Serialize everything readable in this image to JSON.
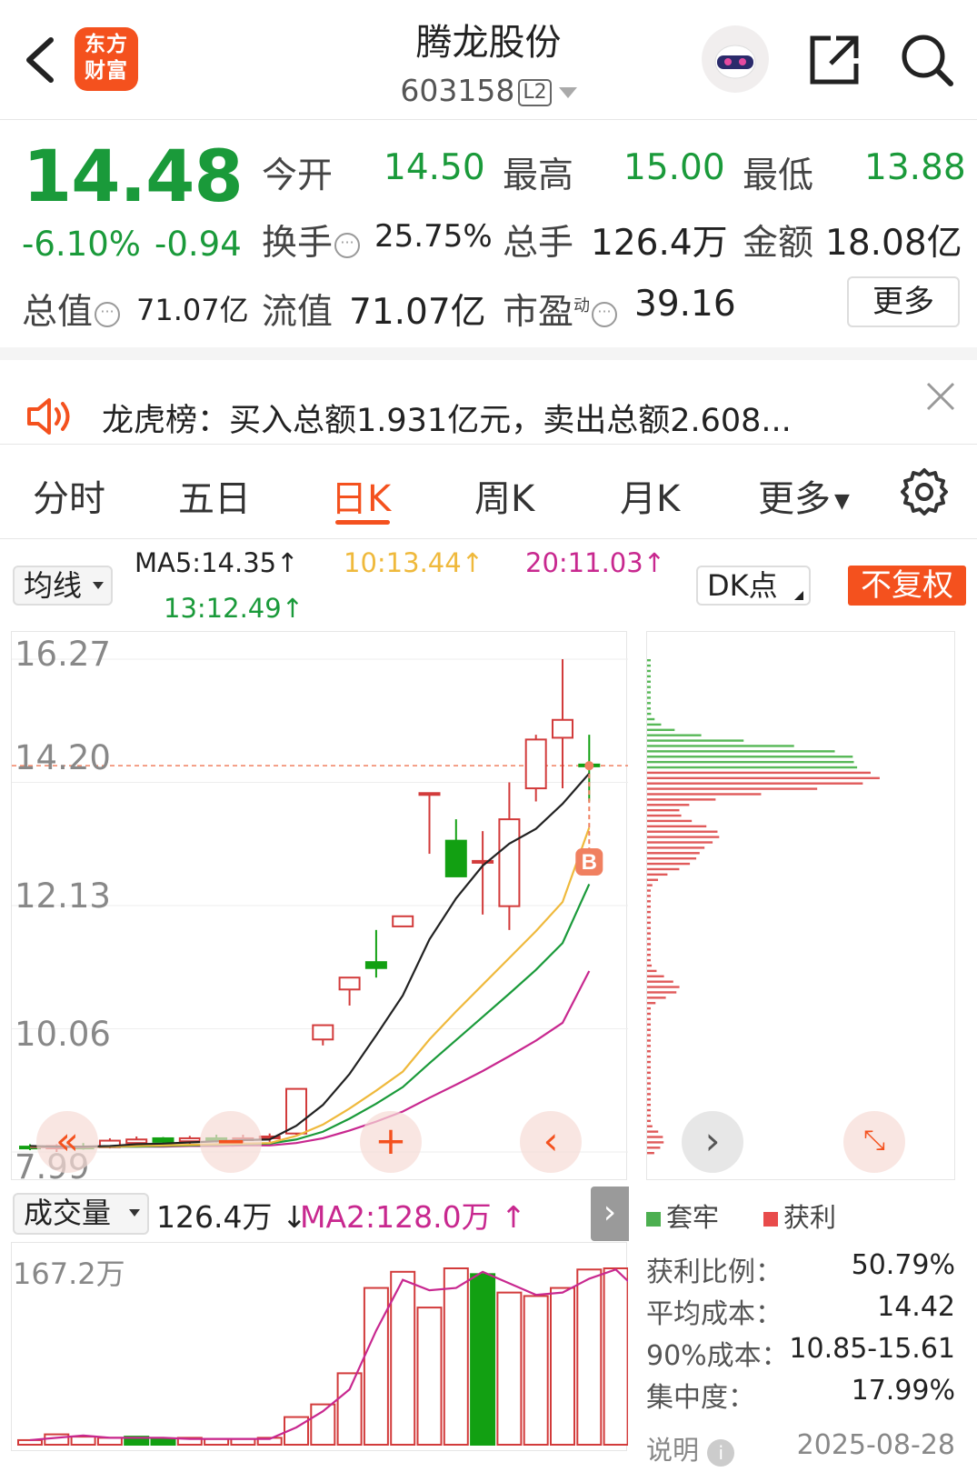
{
  "header": {
    "logo_text_line1": "东方",
    "logo_text_line2": "财富",
    "stock_name": "腾龙股份",
    "stock_code": "603158",
    "level_badge": "L2"
  },
  "quote": {
    "price": "14.48",
    "change_pct": "-6.10%",
    "change_amt": "-0.94",
    "open_label": "今开",
    "open": "14.50",
    "high_label": "最高",
    "high": "15.00",
    "low_label": "最低",
    "low": "13.88",
    "turnover_label": "换手",
    "turnover": "25.75%",
    "volume_label": "总手",
    "volume": "126.4万",
    "amount_label": "金额",
    "amount": "18.08亿",
    "mktcap_label": "总值",
    "mktcap": "71.07亿",
    "float_label": "流值",
    "float_cap": "71.07亿",
    "pe_label": "市盈",
    "pe_super": "动",
    "pe": "39.16",
    "more_label": "更多"
  },
  "news": {
    "text": "龙虎榜：买入总额1.931亿元，卖出总额2.608..."
  },
  "tabs": [
    "分时",
    "五日",
    "日K",
    "周K",
    "月K",
    "更多"
  ],
  "active_tab": "日K",
  "indicators": {
    "ma_dropdown": "均线",
    "ma5": "MA5:14.35",
    "ma10": "10:13.44",
    "ma20": "20:11.03",
    "ma13": "13:12.49",
    "arrow_up": "↑",
    "dk_dropdown": "DK点",
    "no_adjust": "不复权"
  },
  "colors": {
    "up": "#d23b3b",
    "down": "#12a012",
    "ma5": "#222222",
    "ma10": "#efb93c",
    "ma13": "#1a9a3a",
    "ma20": "#c8288f",
    "accent": "#f4511e"
  },
  "chart_data": [
    {
      "type": "candlestick",
      "ylim": [
        7.99,
        16.27
      ],
      "y_ticks": [
        "16.27",
        "14.20",
        "12.13",
        "10.06",
        "7.99"
      ],
      "last_price_line": 14.48,
      "marker": "B",
      "candles": [
        {
          "o": 8.08,
          "h": 8.12,
          "l": 8.02,
          "c": 8.06
        },
        {
          "o": 8.05,
          "h": 8.12,
          "l": 7.99,
          "c": 8.09
        },
        {
          "o": 8.08,
          "h": 8.14,
          "l": 8.03,
          "c": 8.07
        },
        {
          "o": 8.07,
          "h": 8.22,
          "l": 8.05,
          "c": 8.18
        },
        {
          "o": 8.14,
          "h": 8.25,
          "l": 8.1,
          "c": 8.2
        },
        {
          "o": 8.22,
          "h": 8.24,
          "l": 8.14,
          "c": 8.16
        },
        {
          "o": 8.17,
          "h": 8.26,
          "l": 8.12,
          "c": 8.22
        },
        {
          "o": 8.22,
          "h": 8.28,
          "l": 8.15,
          "c": 8.18
        },
        {
          "o": 8.2,
          "h": 8.28,
          "l": 8.12,
          "c": 8.22
        },
        {
          "o": 8.22,
          "h": 8.3,
          "l": 8.16,
          "c": 8.25
        },
        {
          "o": 8.3,
          "h": 9.05,
          "l": 8.28,
          "c": 9.05
        },
        {
          "o": 9.88,
          "h": 10.12,
          "l": 9.78,
          "c": 10.12
        },
        {
          "o": 10.72,
          "h": 10.92,
          "l": 10.45,
          "c": 10.92
        },
        {
          "o": 11.18,
          "h": 11.72,
          "l": 10.92,
          "c": 11.08
        },
        {
          "o": 11.78,
          "h": 11.95,
          "l": 11.78,
          "c": 11.95
        },
        {
          "o": 14.02,
          "h": 14.02,
          "l": 13.0,
          "c": 14.02
        },
        {
          "o": 13.22,
          "h": 13.58,
          "l": 12.62,
          "c": 12.62
        },
        {
          "o": 12.88,
          "h": 13.38,
          "l": 11.98,
          "c": 12.88
        },
        {
          "o": 12.12,
          "h": 14.2,
          "l": 11.72,
          "c": 13.58
        },
        {
          "o": 14.1,
          "h": 15.0,
          "l": 13.88,
          "c": 14.92
        },
        {
          "o": 14.95,
          "h": 16.27,
          "l": 14.1,
          "c": 15.25
        },
        {
          "o": 14.5,
          "h": 15.0,
          "l": 13.88,
          "c": 14.48
        }
      ],
      "ma5": [
        8.09,
        8.08,
        8.08,
        8.09,
        8.12,
        8.13,
        8.15,
        8.17,
        8.19,
        8.2,
        8.43,
        8.78,
        9.3,
        9.95,
        10.62,
        11.56,
        12.25,
        12.8,
        13.17,
        13.42,
        13.84,
        14.35
      ],
      "ma10": [
        8.08,
        8.08,
        8.08,
        8.08,
        8.09,
        8.1,
        8.11,
        8.12,
        8.13,
        8.14,
        8.26,
        8.45,
        8.72,
        9.02,
        9.34,
        9.88,
        10.35,
        10.8,
        11.25,
        11.7,
        12.19,
        13.44
      ],
      "ma13": [
        8.08,
        8.08,
        8.08,
        8.08,
        8.08,
        8.09,
        8.1,
        8.11,
        8.12,
        8.13,
        8.2,
        8.33,
        8.55,
        8.8,
        9.08,
        9.48,
        9.87,
        10.26,
        10.65,
        11.05,
        11.5,
        12.49
      ],
      "ma20": [
        8.07,
        8.07,
        8.07,
        8.08,
        8.08,
        8.08,
        8.09,
        8.09,
        8.1,
        8.1,
        8.14,
        8.22,
        8.35,
        8.5,
        8.67,
        8.9,
        9.12,
        9.35,
        9.6,
        9.86,
        10.16,
        11.03
      ]
    },
    {
      "type": "bar",
      "title": "成交量",
      "current": "126.4万",
      "ma2": "MA2:128.0万",
      "y_top_label": "167.2万",
      "values": [
        4,
        9,
        7,
        6,
        7,
        5,
        6,
        5,
        5,
        6,
        24,
        35,
        62,
        136,
        150,
        119,
        153,
        148,
        132,
        129,
        136,
        152,
        153,
        107,
        126.4
      ],
      "ma2_values": [
        4,
        6,
        8,
        6,
        6,
        6,
        5,
        5,
        5,
        5,
        15,
        29,
        48,
        99,
        143,
        134,
        136,
        150,
        140,
        130,
        132,
        144,
        152,
        130,
        128
      ],
      "down_flags": [
        0,
        0,
        0,
        0,
        1,
        1,
        0,
        0,
        0,
        0,
        0,
        0,
        0,
        0,
        0,
        0,
        0,
        1,
        0,
        0,
        0,
        0,
        0,
        0,
        1
      ],
      "ylim": [
        0,
        167.2
      ]
    }
  ],
  "cost_dist": {
    "legend_trapped": "套牢",
    "legend_profit": "获利",
    "profit_ratio_label": "获利比例：",
    "profit_ratio": "50.79%",
    "avg_cost_label": "平均成本：",
    "avg_cost": "14.42",
    "cost90_label": "90%成本：",
    "cost90": "10.85-15.61",
    "concentration_label": "集中度：",
    "concentration": "17.99%",
    "note_label": "说明",
    "date": "2025-08-28"
  }
}
